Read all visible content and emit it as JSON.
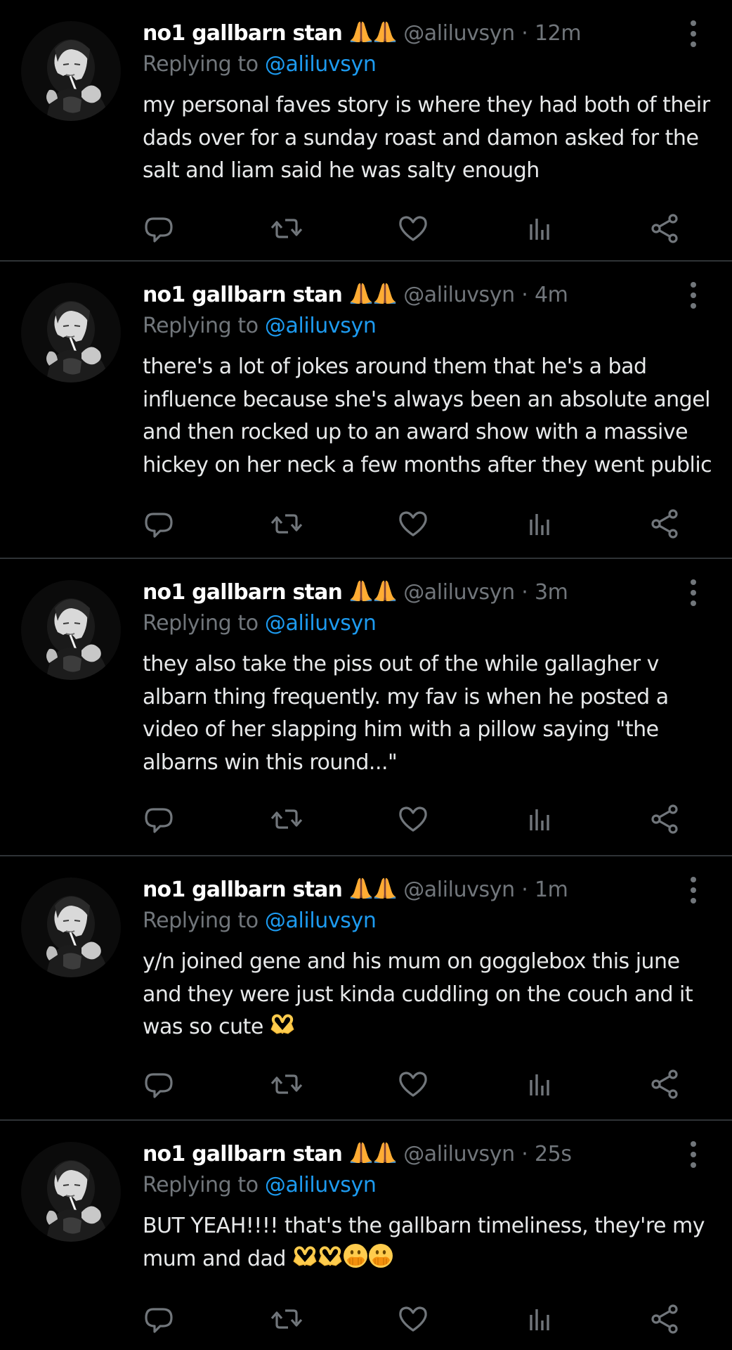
{
  "colors": {
    "background": "#000000",
    "text": "#e7e9ea",
    "muted": "#71767b",
    "link": "#1d9bf0",
    "divider": "#2f3336"
  },
  "icons": {
    "reply": "speech-bubble-icon",
    "retweet": "retweet-arrows-icon",
    "like": "heart-outline-icon",
    "views": "bar-chart-icon",
    "share": "share-nodes-icon",
    "more": "vertical-ellipsis-icon",
    "name_emoji": "folded-hands-emoji",
    "heart_hands": "heart-hands-emoji",
    "peeking": "face-with-peeking-eye-emoji"
  },
  "tweets": [
    {
      "display_name": "no1 gallbarn stan",
      "handle": "@aliluvsyn",
      "separator": "·",
      "time": "12m",
      "replying_prefix": "Replying to",
      "replying_to": "@aliluvsyn",
      "text": "my personal faves story is where they had both of their dads over for a sunday roast and damon asked for the salt and liam said he was salty enough"
    },
    {
      "display_name": "no1 gallbarn stan",
      "handle": "@aliluvsyn",
      "separator": "·",
      "time": "4m",
      "replying_prefix": "Replying to",
      "replying_to": "@aliluvsyn",
      "text": "there's a lot of jokes around them that he's a bad influence because she's always been an absolute angel and then rocked up to an award show with a massive hickey on her neck a few months after they went public"
    },
    {
      "display_name": "no1 gallbarn stan",
      "handle": "@aliluvsyn",
      "separator": "·",
      "time": "3m",
      "replying_prefix": "Replying to",
      "replying_to": "@aliluvsyn",
      "text": "they also take the piss out of the while gallagher v albarn thing frequently. my fav is when he posted a video of her slapping him with a pillow saying \"the albarns win this round...\""
    },
    {
      "display_name": "no1 gallbarn stan",
      "handle": "@aliluvsyn",
      "separator": "·",
      "time": "1m",
      "replying_prefix": "Replying to",
      "replying_to": "@aliluvsyn",
      "text": "y/n joined gene and his mum on gogglebox this june and they were just kinda cuddling on the couch and it was so cute"
    },
    {
      "display_name": "no1 gallbarn stan",
      "handle": "@aliluvsyn",
      "separator": "·",
      "time": "25s",
      "replying_prefix": "Replying to",
      "replying_to": "@aliluvsyn",
      "text": "BUT YEAH!!!! that's the gallbarn timeliness, they're my mum and dad"
    }
  ]
}
